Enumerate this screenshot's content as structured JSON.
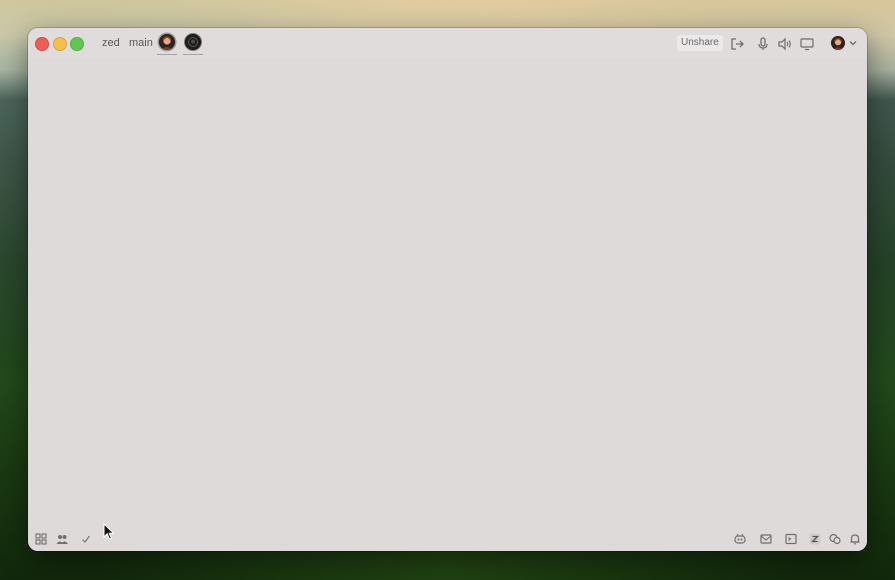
{
  "window": {
    "project_name": "zed",
    "branch_name": "main"
  },
  "titlebar": {
    "unshare_label": "Unshare",
    "icons": [
      "leave-call-icon",
      "microphone-icon",
      "speaker-icon",
      "screen-share-icon",
      "chevron-down-icon"
    ],
    "collaborators": [
      "collaborator-avatar",
      "collaborator-avatar"
    ]
  },
  "statusbar": {
    "left_icons": [
      "project-panel-icon",
      "collab-panel-icon",
      "diagnostics-check-icon"
    ],
    "right_icons": [
      "copilot-icon",
      "feedback-icon",
      "terminal-icon",
      "zed-predict-icon",
      "chat-icon",
      "bell-icon"
    ]
  },
  "colors": {
    "window_background": "#dddad9",
    "close": "#ec5f57",
    "minimize": "#f4bf4f",
    "maximize": "#62c655"
  }
}
